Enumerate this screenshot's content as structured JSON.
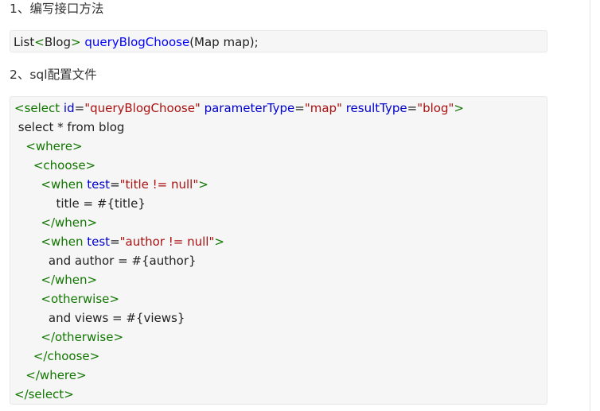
{
  "headings": {
    "step1": "1、编写接口方法",
    "step2": "2、sql配置文件"
  },
  "interface_code": {
    "type_prefix": "List",
    "lt": "<",
    "generic": "Blog",
    "gt": ">",
    "space": " ",
    "method": "queryBlogChoose",
    "params": "(Map map);"
  },
  "xml_code": {
    "l1": {
      "open": "<select",
      "a1": " id",
      "eq1": "=",
      "v1": "\"queryBlogChoose\"",
      "a2": " parameterType",
      "eq2": "=",
      "v2": "\"map\"",
      "a3": " resultType",
      "eq3": "=",
      "v3": "\"blog\"",
      "close": ">"
    },
    "l2": " select * from blog",
    "l3": "   <where>",
    "l4": "     <choose>",
    "l5": {
      "indent": "       ",
      "open": "<when",
      "a1": " test",
      "eq1": "=",
      "v1": "\"title != null\"",
      "close": ">"
    },
    "l6": "           title = #{title}",
    "l7": "       </when>",
    "l8": {
      "indent": "       ",
      "open": "<when",
      "a1": " test",
      "eq1": "=",
      "v1": "\"author != null\"",
      "close": ">"
    },
    "l9": "         and author = #{author}",
    "l10": "       </when>",
    "l11": "       <otherwise>",
    "l12": "         and views = #{views}",
    "l13": "       </otherwise>",
    "l14": "     </choose>",
    "l15": "   </where>",
    "l16": "</select>"
  }
}
